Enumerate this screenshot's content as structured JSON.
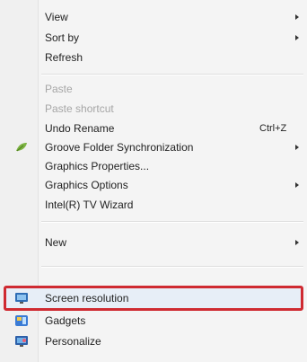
{
  "menu": {
    "items": {
      "view": "View",
      "sort_by": "Sort by",
      "refresh": "Refresh",
      "paste": "Paste",
      "paste_shortcut": "Paste shortcut",
      "undo_rename": "Undo Rename",
      "undo_rename_shortcut": "Ctrl+Z",
      "groove": "Groove Folder Synchronization",
      "graphics_properties": "Graphics Properties...",
      "graphics_options": "Graphics Options",
      "intel_tv_wizard": "Intel(R) TV Wizard",
      "new": "New",
      "screen_resolution": "Screen resolution",
      "gadgets": "Gadgets",
      "personalize": "Personalize"
    },
    "colors": {
      "highlight_border": "#cf2a31",
      "disabled_text": "#a6a6a6"
    },
    "icons": {
      "groove": "groove-leaf-icon",
      "screen_resolution": "display-monitor-icon",
      "gadgets": "gadgets-icon",
      "personalize": "personalize-icon"
    }
  }
}
